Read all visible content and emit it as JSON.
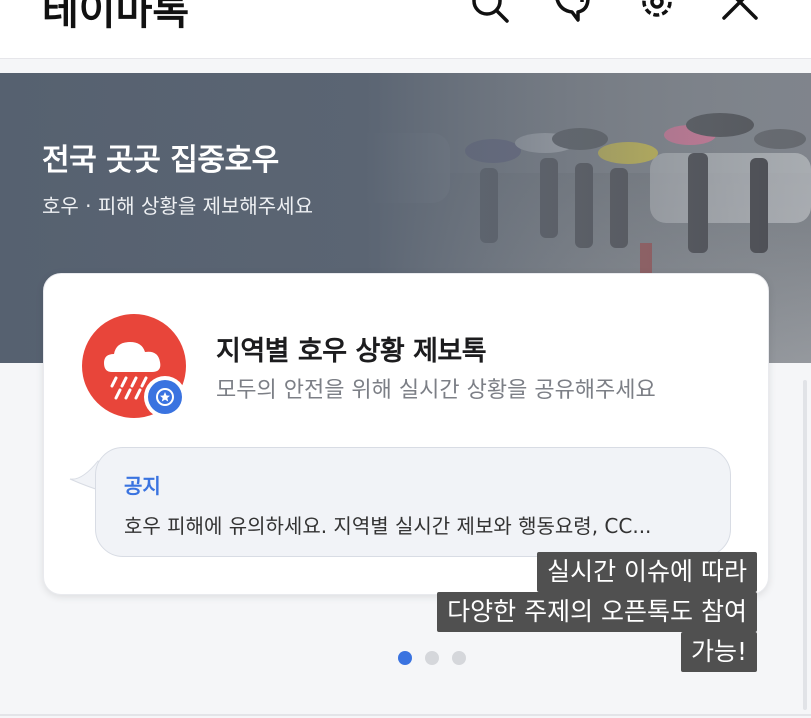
{
  "header": {
    "title": "테이마톡",
    "icons": [
      "search-icon",
      "add-chat-icon",
      "settings-icon",
      "close-icon"
    ]
  },
  "banner": {
    "title": "전국 곳곳 집중호우",
    "subtitle": "호우 · 피해 상황을 제보해주세요",
    "image": "rainy-street-photo"
  },
  "card": {
    "room_title": "지역별 호우 상황 제보톡",
    "room_description": "모두의 안전을 위해 실시간 상황을 공유해주세요",
    "notice_label": "공지",
    "notice_text": "호우 피해에 유의하세요. 지역별 실시간 제보와 행동요령, CC..."
  },
  "pager": {
    "total": 3,
    "active": 1
  },
  "caption": {
    "line1": "실시간 이슈에 따라",
    "line2": "다양한 주제의 오픈톡도 참여",
    "line3": "가능!"
  },
  "colors": {
    "accent": "#3a73e0",
    "avatar": "#e8453a",
    "banner_bg": "#586270",
    "caption_bg": "#505050"
  }
}
